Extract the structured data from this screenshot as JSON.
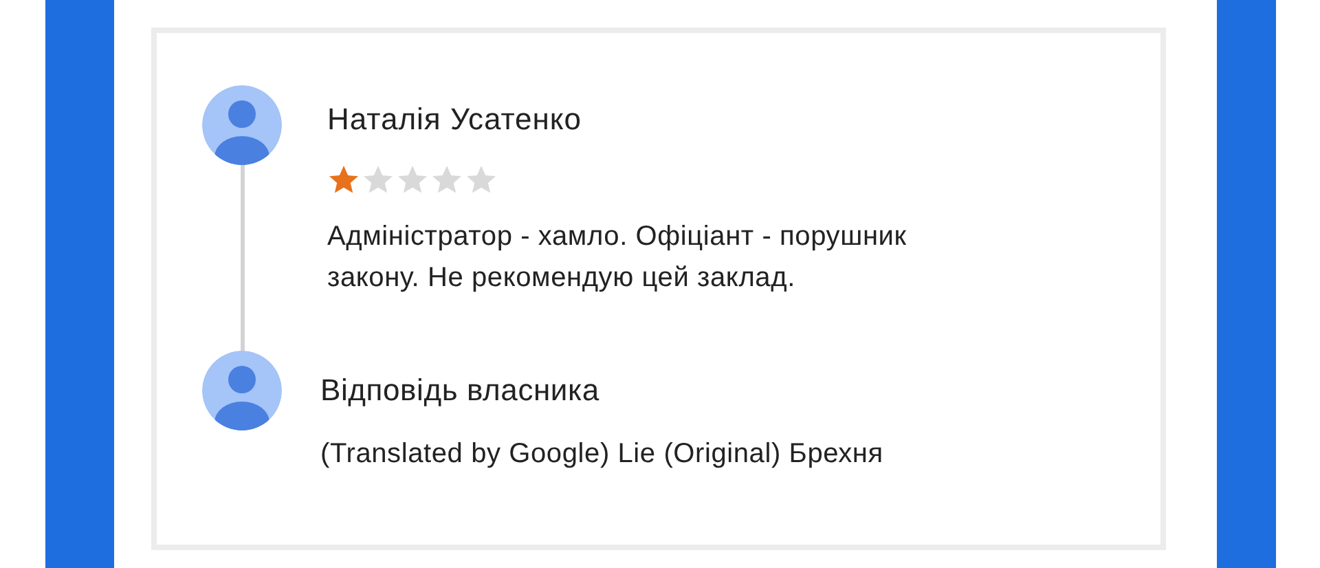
{
  "review": {
    "author": "Наталія Усатенко",
    "stars": 1,
    "text": "Адміністратор - хамло. Офіціант - порушник закону. Не рекомендую цей заклад."
  },
  "owner_response": {
    "title": "Відповідь власника",
    "text": "(Translated by Google) Lie (Original) Брехня"
  }
}
